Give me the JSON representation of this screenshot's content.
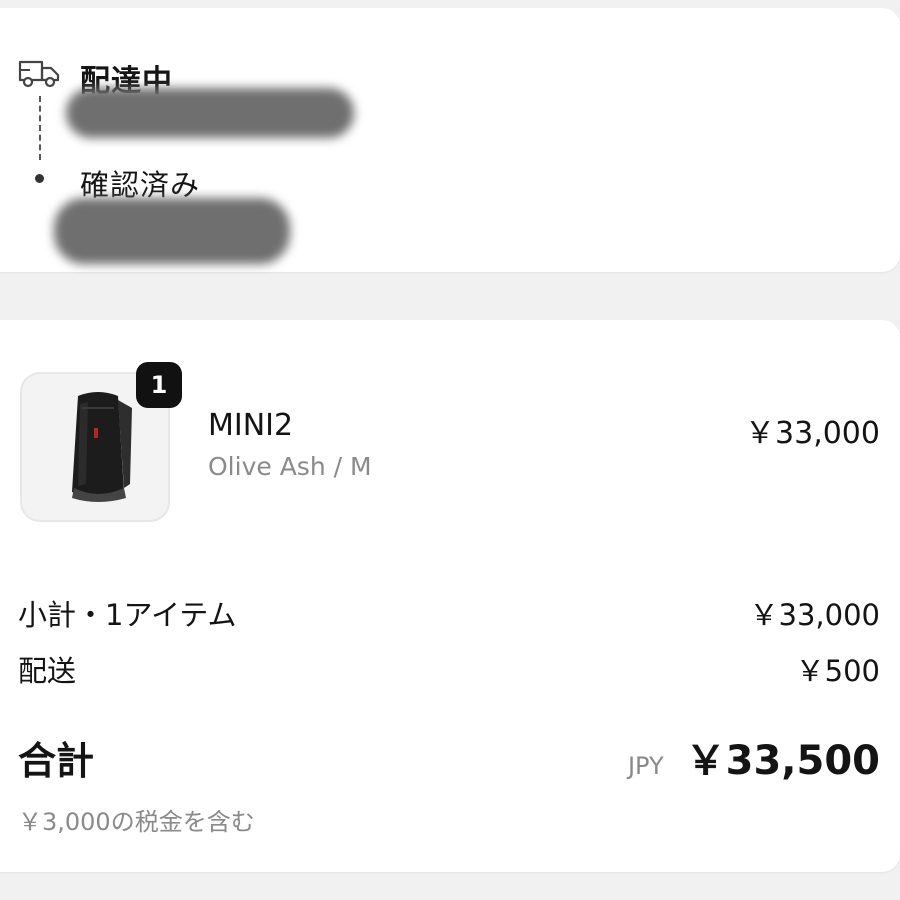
{
  "status": {
    "title": "配達中",
    "confirmed": "確認済み",
    "icon": "truck-icon"
  },
  "order": {
    "item": {
      "quantity": "1",
      "name": "MINI2",
      "variant": "Olive Ash / M",
      "price": "￥33,000"
    },
    "subtotal": {
      "label": "小計・1アイテム",
      "value": "￥33,000"
    },
    "shipping": {
      "label": "配送",
      "value": "￥500"
    },
    "total": {
      "label": "合計",
      "currency": "JPY",
      "value": "￥33,500"
    },
    "tax_note": "￥3,000の税金を含む"
  },
  "colors": {
    "background": "#f1f1f1",
    "card": "#ffffff",
    "muted_text": "#8a8a8a",
    "badge": "#111111"
  }
}
